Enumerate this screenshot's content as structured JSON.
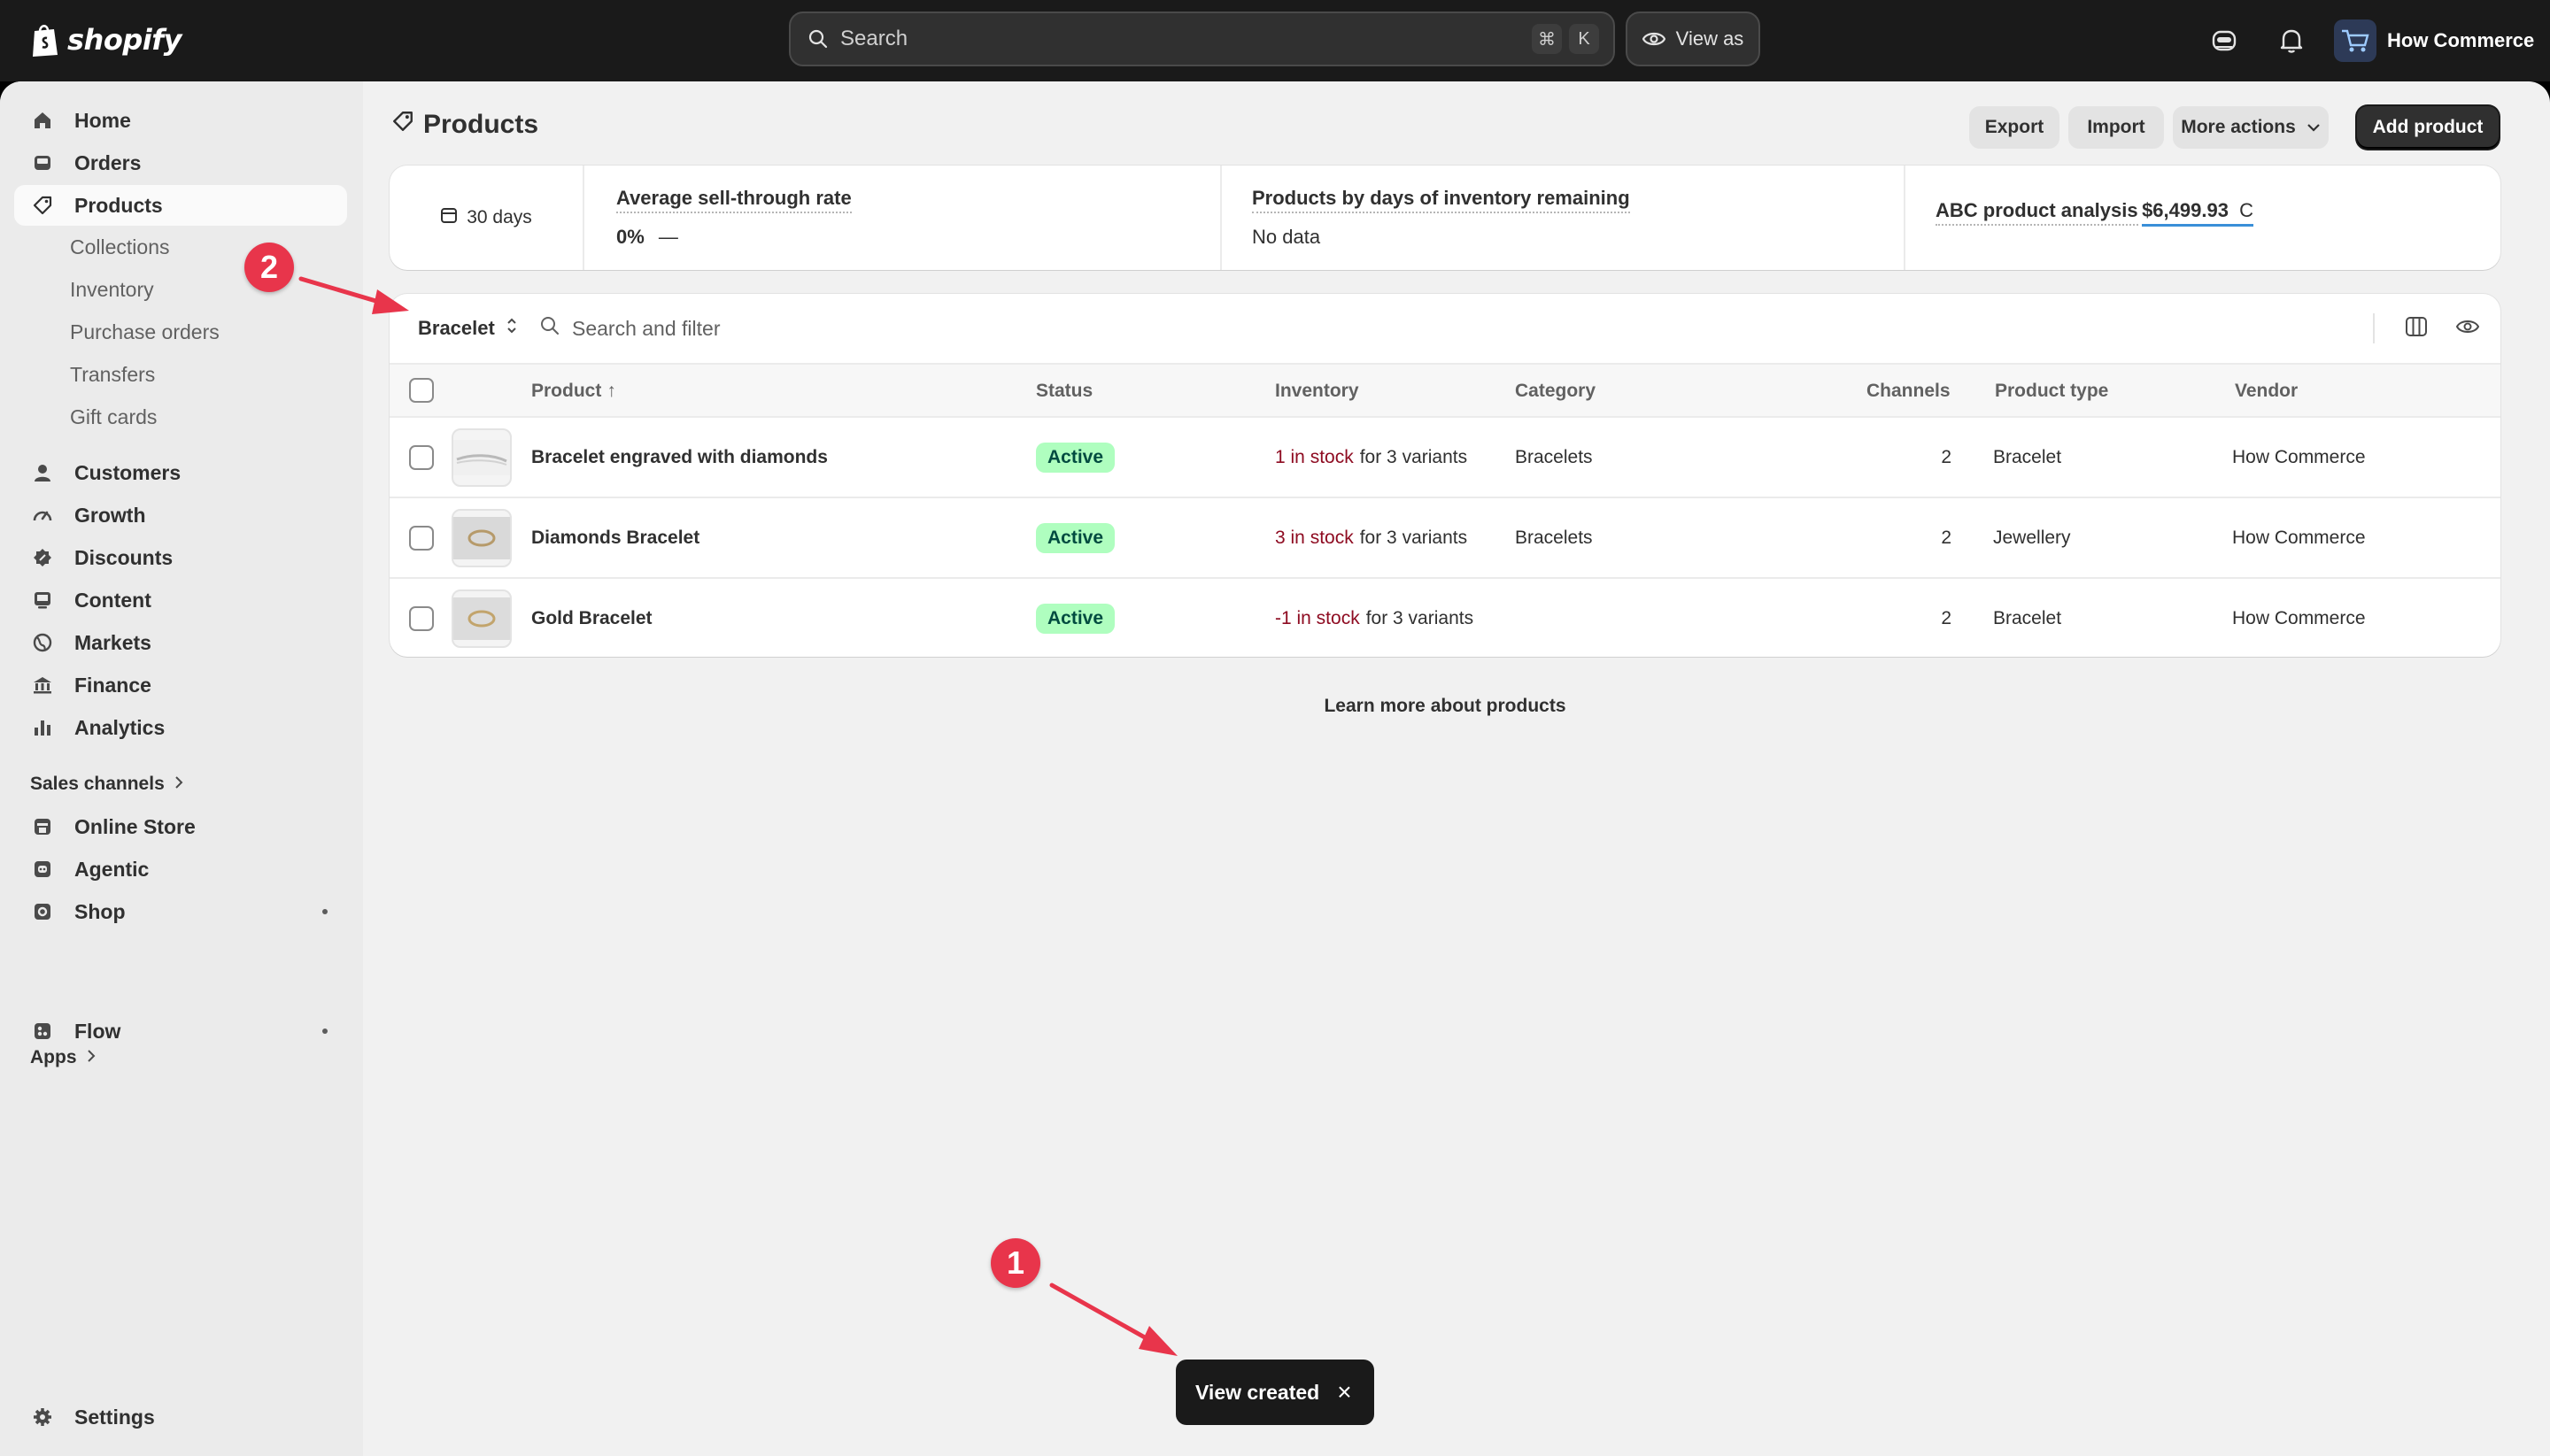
{
  "brand": {
    "name": "shopify"
  },
  "topbar": {
    "search_placeholder": "Search",
    "search_shortcut": [
      "⌘",
      "K"
    ],
    "view_as_label": "View as",
    "store_name": "How Commerce"
  },
  "sidebar": {
    "items": [
      {
        "label": "Home",
        "icon": "home-icon"
      },
      {
        "label": "Orders",
        "icon": "inbox-icon"
      },
      {
        "label": "Products",
        "icon": "tag-icon",
        "active": true
      }
    ],
    "product_subitems": [
      "Collections",
      "Inventory",
      "Purchase orders",
      "Transfers",
      "Gift cards"
    ],
    "items2": [
      {
        "label": "Customers",
        "icon": "person-icon"
      },
      {
        "label": "Growth",
        "icon": "gauge-icon"
      },
      {
        "label": "Discounts",
        "icon": "discount-icon"
      },
      {
        "label": "Content",
        "icon": "content-icon"
      },
      {
        "label": "Markets",
        "icon": "globe-icon"
      },
      {
        "label": "Finance",
        "icon": "bank-icon"
      },
      {
        "label": "Analytics",
        "icon": "bar-chart-icon"
      }
    ],
    "sales_channels_label": "Sales channels",
    "channels": [
      {
        "label": "Online Store",
        "icon": "store-icon"
      },
      {
        "label": "Agentic",
        "icon": "agentic-icon"
      },
      {
        "label": "Shop",
        "icon": "shop-icon"
      }
    ],
    "apps_label": "Apps",
    "apps": [
      {
        "label": "Flow",
        "icon": "flow-icon"
      }
    ],
    "settings_label": "Settings"
  },
  "page": {
    "title": "Products",
    "actions": {
      "export": "Export",
      "import": "Import",
      "more": "More actions",
      "add": "Add product"
    }
  },
  "analytics": {
    "date_range": "30 days",
    "metrics": [
      {
        "label": "Average sell-through rate",
        "value": "0%",
        "trend": "—"
      },
      {
        "label": "Products by days of inventory remaining",
        "value": "No data"
      },
      {
        "label": "ABC product analysis",
        "value": "$6,499.93",
        "grade": "C"
      }
    ]
  },
  "table": {
    "current_view": "Bracelet",
    "search_placeholder": "Search and filter",
    "columns": {
      "product": "Product",
      "status": "Status",
      "inventory": "Inventory",
      "category": "Category",
      "channels": "Channels",
      "product_type": "Product type",
      "vendor": "Vendor"
    },
    "sort_indicator": "↑",
    "rows": [
      {
        "name": "Bracelet engraved with diamonds",
        "status": "Active",
        "stock": "1 in stock",
        "variants": "for 3 variants",
        "category": "Bracelets",
        "channels": "2",
        "type": "Bracelet",
        "vendor": "How Commerce"
      },
      {
        "name": "Diamonds Bracelet",
        "status": "Active",
        "stock": "3 in stock",
        "variants": "for 3 variants",
        "category": "Bracelets",
        "channels": "2",
        "type": "Jewellery",
        "vendor": "How Commerce"
      },
      {
        "name": "Gold Bracelet",
        "status": "Active",
        "stock": "-1 in stock",
        "variants": "for 3 variants",
        "category": "",
        "channels": "2",
        "type": "Bracelet",
        "vendor": "How Commerce"
      }
    ]
  },
  "learn_more": "Learn more about products",
  "toast": {
    "message": "View created",
    "close": "×"
  },
  "annotations": {
    "marker_1": "1",
    "marker_2": "2"
  },
  "colors": {
    "accent_marker": "#e8354b",
    "badge_bg": "#affebf",
    "stock_red": "#8e0b21"
  }
}
